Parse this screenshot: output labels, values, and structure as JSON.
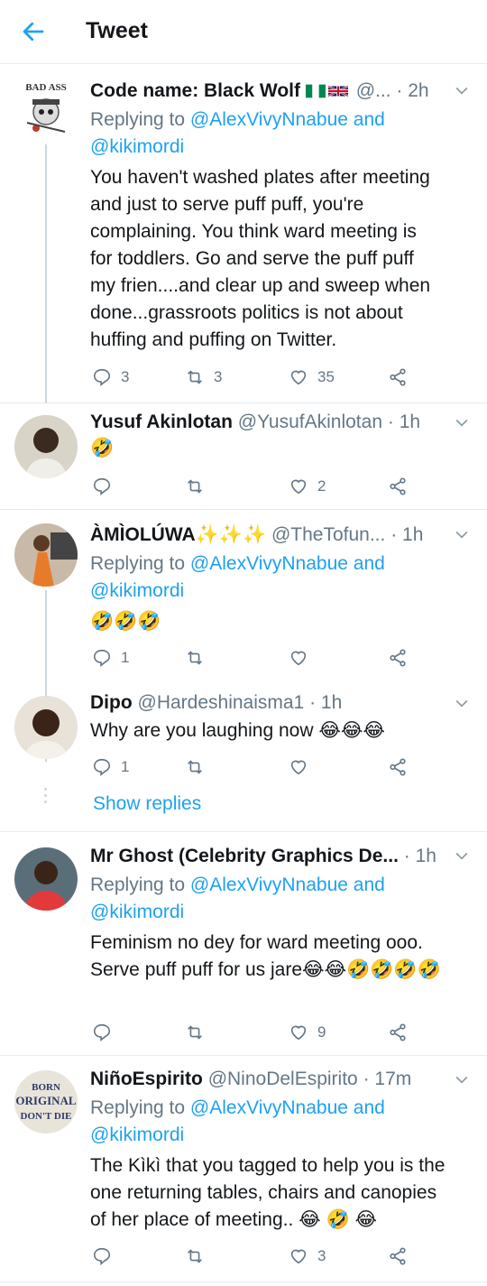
{
  "header": {
    "title": "Tweet",
    "back_icon": "arrow-left-icon"
  },
  "colors": {
    "accent": "#1da1f2",
    "muted": "#657786",
    "text": "#14171a",
    "divider": "#e6ecf0"
  },
  "tweets": [
    {
      "name": "Code name: Black Wolf",
      "name_extras": "🇳🇬 🇬🇧",
      "handle": "@...",
      "time": "2h",
      "reply_prefix": "Replying to",
      "reply_to": "@AlexVivyNnabue and",
      "reply_to_2": "@kikimordi",
      "text_lines": [
        "You haven't washed plates after meeting",
        "and just to serve puff puff, you're",
        "complaining. You think ward meeting is",
        "for toddlers. Go and serve the puff puff",
        "my frien....and clear up and sweep when",
        "done...grassroots politics is not about",
        "huffing and puffing on Twitter."
      ],
      "replies": "3",
      "retweets": "3",
      "likes": "35"
    },
    {
      "name": "Yusuf Akinlotan",
      "handle": "@YusufAkinlotan",
      "time": "1h",
      "text_emoji": "🤣",
      "replies": "",
      "retweets": "",
      "likes": "2"
    },
    {
      "name": "ÀMÌOLÚWA",
      "name_extras": "✨✨✨",
      "handle": "@TheTofun...",
      "time": "1h",
      "reply_prefix": "Replying to",
      "reply_to": "@AlexVivyNnabue and",
      "reply_to_2": "@kikimordi",
      "text_emoji": "🤣🤣🤣",
      "replies": "1",
      "retweets": "",
      "likes": ""
    },
    {
      "name": "Dipo",
      "handle": "@Hardeshinaisma1",
      "time": "1h",
      "text": "Why are you laughing now",
      "text_emoji": "😂😂😂",
      "replies": "1",
      "retweets": "",
      "likes": "",
      "show_replies": "Show replies"
    },
    {
      "name": "Mr Ghost (Celebrity Graphics De...",
      "handle": "",
      "time": "1h",
      "reply_prefix": "Replying to",
      "reply_to": "@AlexVivyNnabue and",
      "reply_to_2": "@kikimordi",
      "text_lines": [
        "Feminism no dey for ward meeting ooo.",
        "Serve puff puff for us jare"
      ],
      "text_emoji": "😂😂🤣🤣🤣🤣",
      "replies": "",
      "retweets": "",
      "likes": "9"
    },
    {
      "name": "NiñoEspirito",
      "handle": "@NinoDelEspirito",
      "time": "17m",
      "reply_prefix": "Replying to",
      "reply_to": "@AlexVivyNnabue and",
      "reply_to_2": "@kikimordi",
      "text_lines": [
        "The Kìkì that you tagged to help you is the",
        "one returning tables, chairs and canopies",
        "of her place of meeting.."
      ],
      "text_emoji": "😂 🤣 😂",
      "replies": "",
      "retweets": "",
      "likes": "3"
    }
  ],
  "dot_sep": "·"
}
